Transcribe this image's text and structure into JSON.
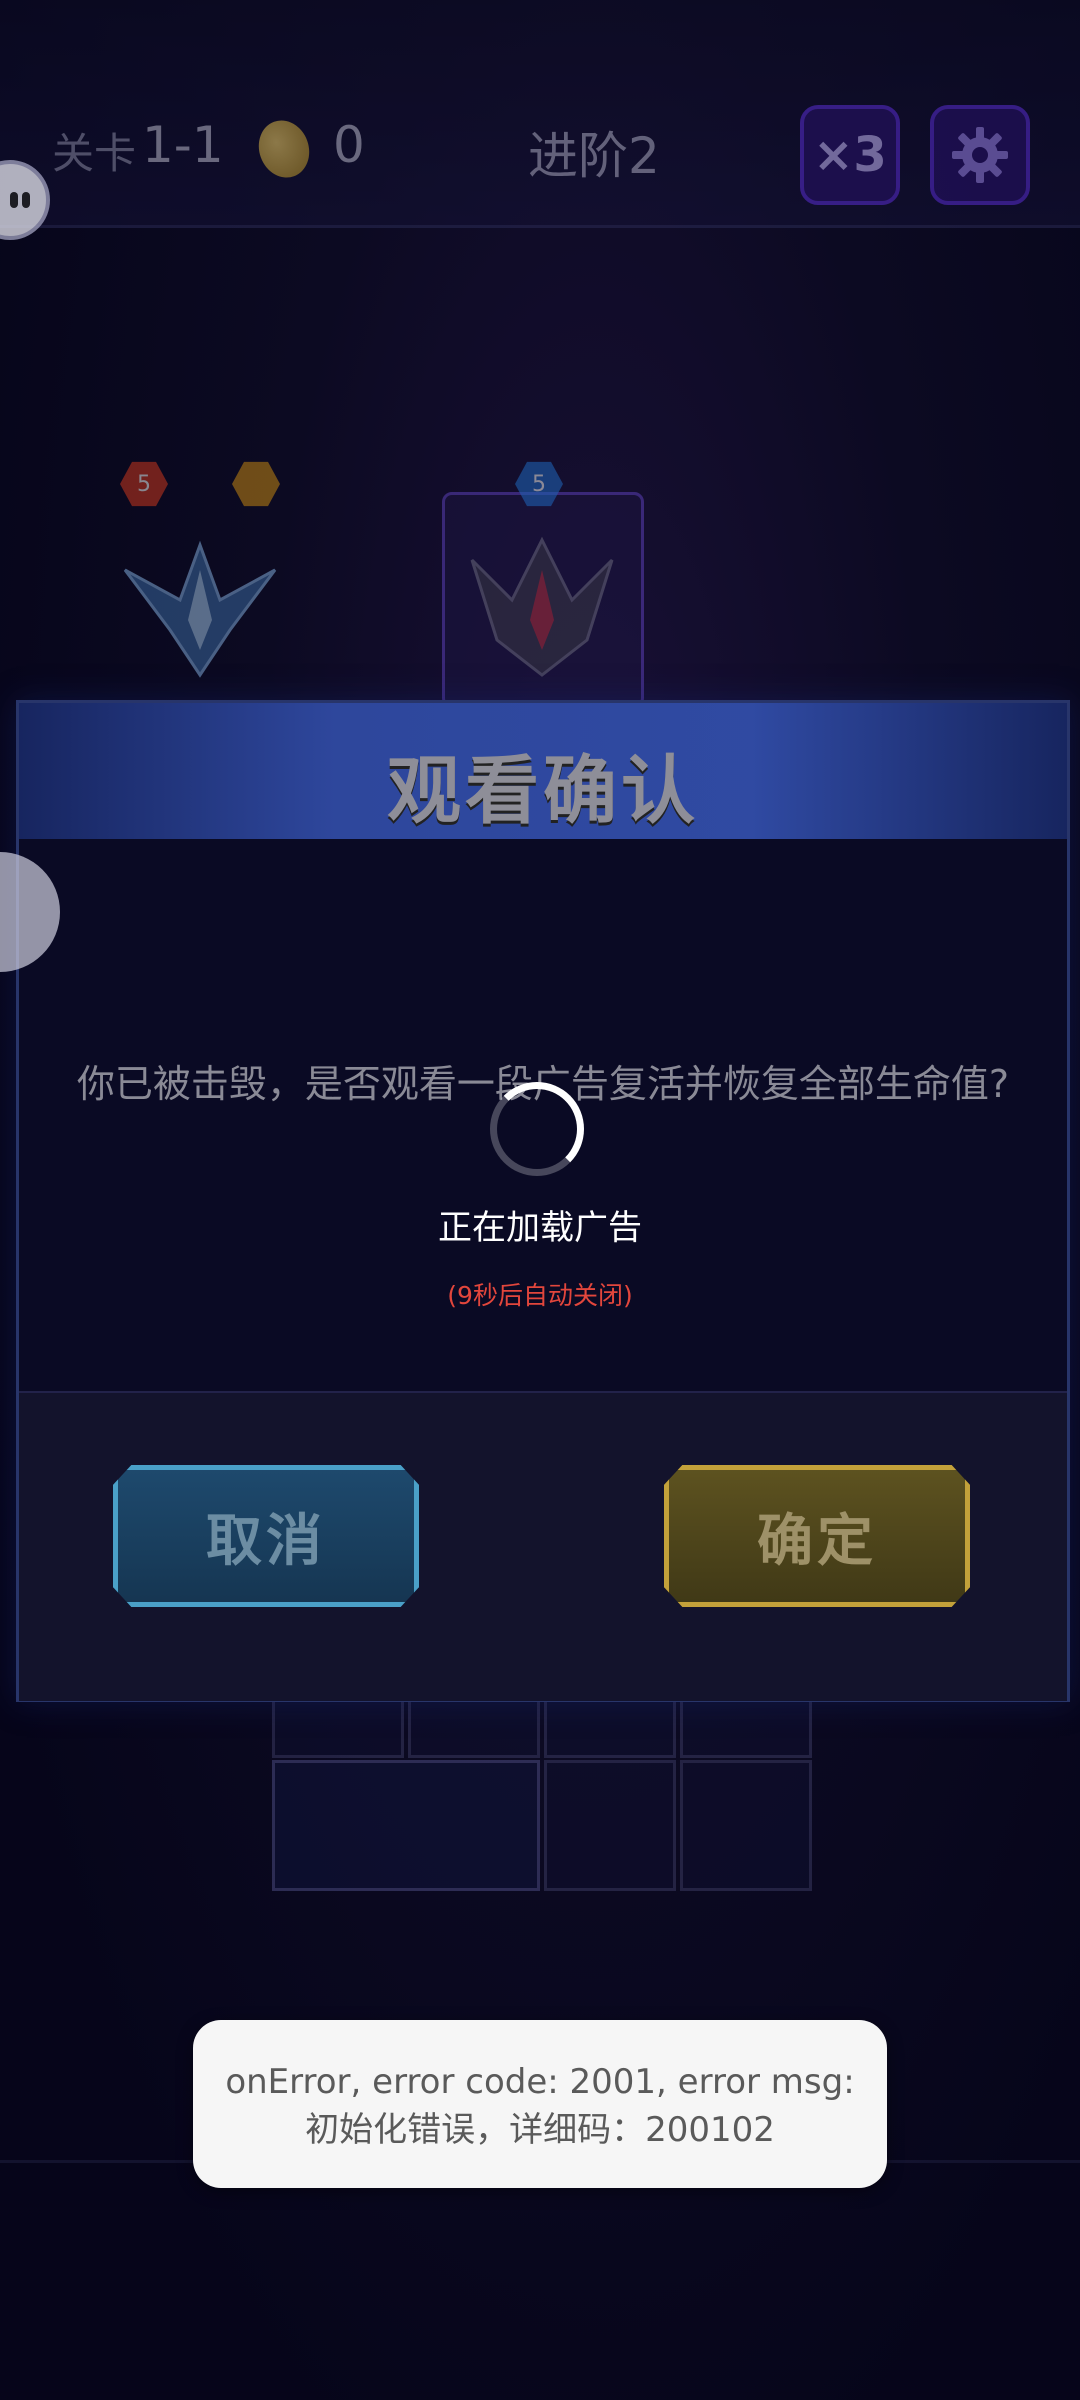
{
  "hud": {
    "level_label": "关卡",
    "level_value": "1-1",
    "coin_icon": "coin-icon",
    "coin_value": "0",
    "stage_label": "进阶2",
    "speed_label": "×3",
    "settings_icon": "gear-icon"
  },
  "background": {
    "ship_badges": [
      "5",
      "5"
    ]
  },
  "modal": {
    "title": "观看确认",
    "message": "你已被击毁，是否观看一段广告复活并恢复全部生命值?",
    "cancel_label": "取消",
    "confirm_label": "确定"
  },
  "loading": {
    "text": "正在加载广告",
    "auto_close": "(9秒后自动关闭)"
  },
  "toast": {
    "message": "onError, error code: 2001, error msg: 初始化错误，详细码：200102"
  },
  "colors": {
    "background": "#07061a",
    "modal_header": "#3a5bc4",
    "cancel_accent": "#4aa0c8",
    "confirm_accent": "#c3a13a",
    "countdown": "#e2463c",
    "toast_bg": "#f6f6f6"
  }
}
